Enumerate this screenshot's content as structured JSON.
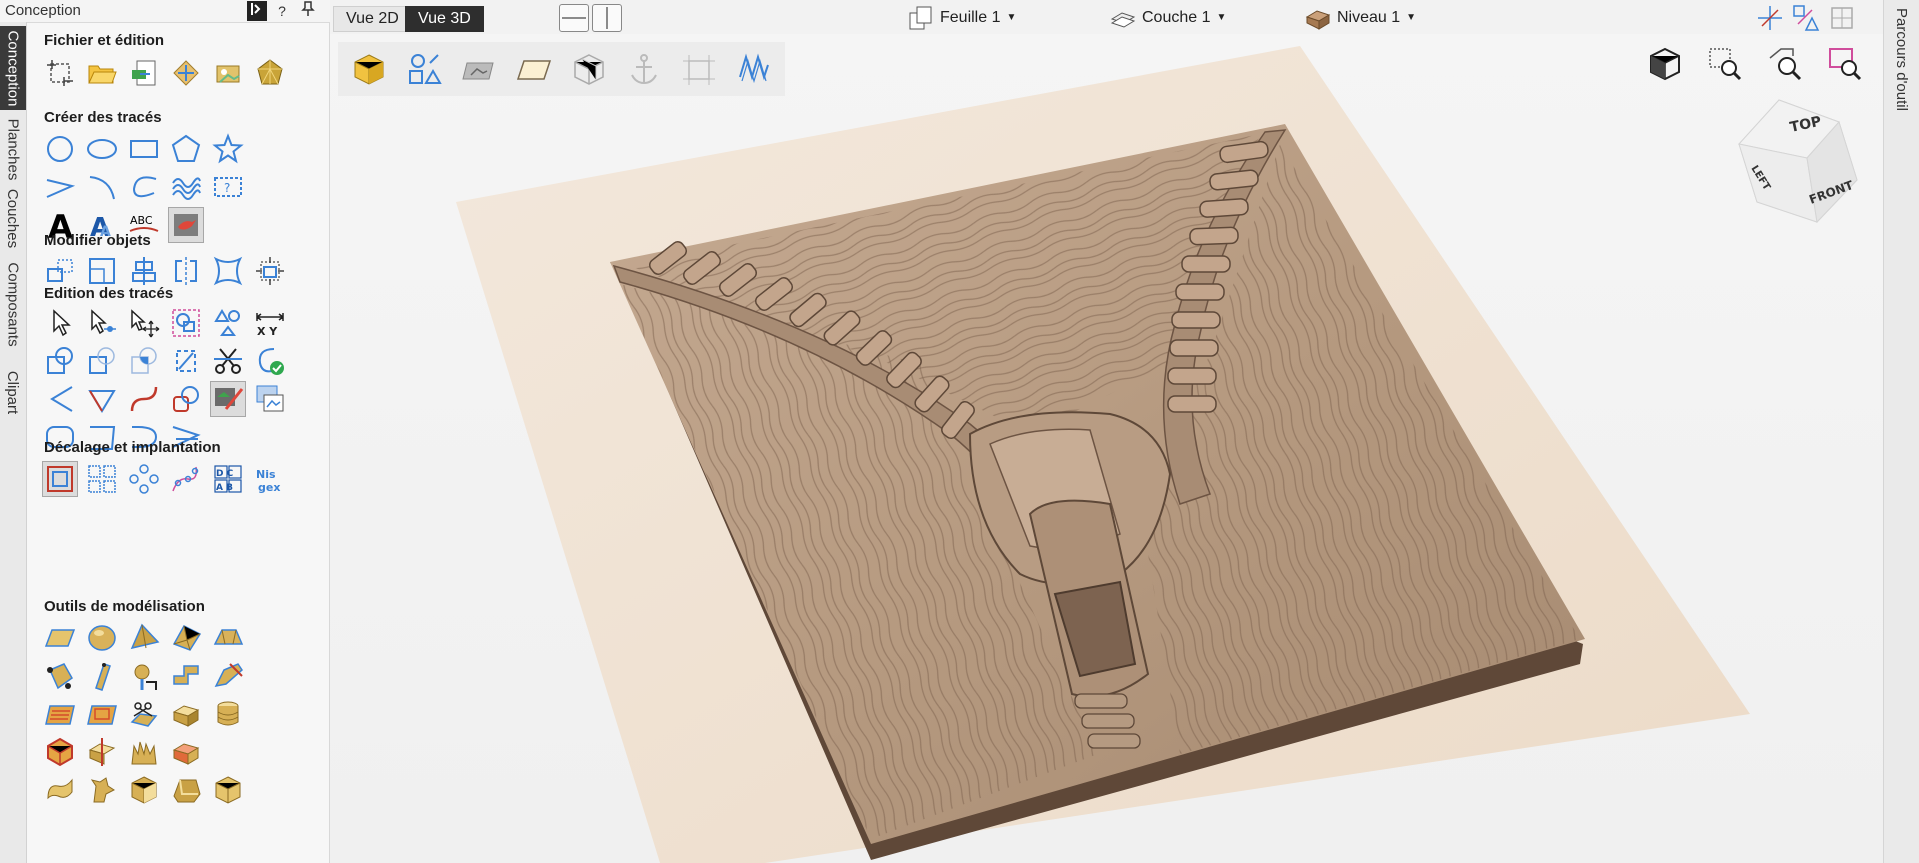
{
  "panel": {
    "title": "Conception",
    "help_label": "?",
    "sections": [
      {
        "title": "Fichier et édition"
      },
      {
        "title": "Créer des tracés"
      },
      {
        "title": "Modifier objets"
      },
      {
        "title": "Edition des tracés"
      },
      {
        "title": "Décalage et implantation"
      },
      {
        "title": "Outils de modélisation"
      }
    ]
  },
  "left_tabs": [
    "Conception",
    "Planches",
    "Couches",
    "Composants",
    "Clipart"
  ],
  "right_tabs": [
    "Parcours d'outil"
  ],
  "topbar": {
    "view2d": "Vue 2D",
    "view3d": "Vue 3D",
    "sheet": "Feuille 1",
    "layer": "Couche 1",
    "level": "Niveau 1"
  },
  "tool_glyphs": {
    "abc": "ABC",
    "text_a": "A",
    "xy": "X Y",
    "dc": "D C",
    "ab": "A B",
    "nest": "Nis gex"
  },
  "viewcube": {
    "top": "TOP",
    "left": "LEFT",
    "front": "FRONT"
  },
  "colors": {
    "accent": "#3b82d6",
    "model": "#b89b82",
    "board": "#efe2d4"
  }
}
